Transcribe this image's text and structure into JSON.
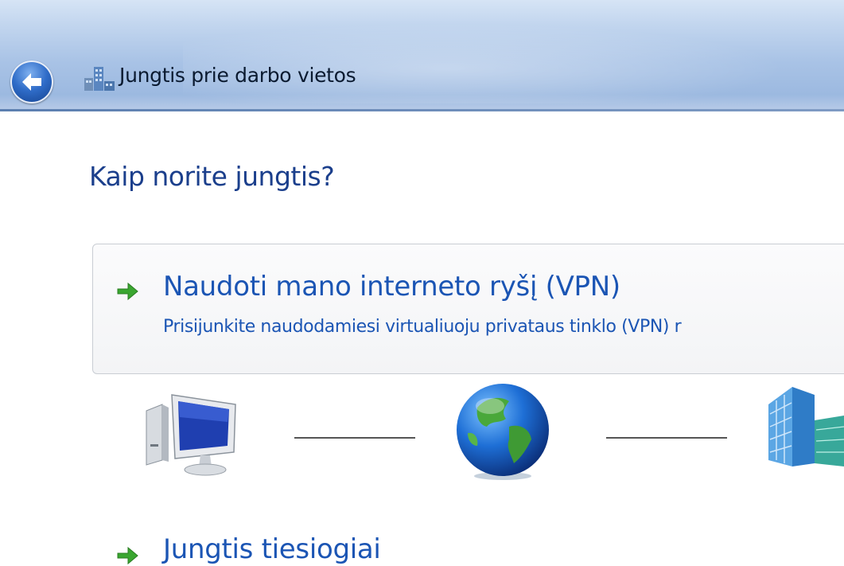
{
  "window": {
    "title": "Jungtis prie darbo vietos",
    "back_icon": "back-arrow-icon",
    "app_icon": "workplace-network-icon"
  },
  "page": {
    "heading": "Kaip norite jungtis?"
  },
  "options": [
    {
      "title": "Naudoti mano interneto ryšį (VPN)",
      "description": "Prisijunkite naudodamiesi virtualiuoju privataus tinklo (VPN) r",
      "icon": "green-arrow-icon"
    },
    {
      "title": "Jungtis tiesiogiai",
      "icon": "green-arrow-icon"
    }
  ],
  "diagram": {
    "nodes": [
      "computer-icon",
      "globe-icon",
      "office-building-icon"
    ]
  },
  "colors": {
    "heading": "#1b3f8c",
    "link": "#1b55b4",
    "accent_arrow": "#3aa630"
  }
}
